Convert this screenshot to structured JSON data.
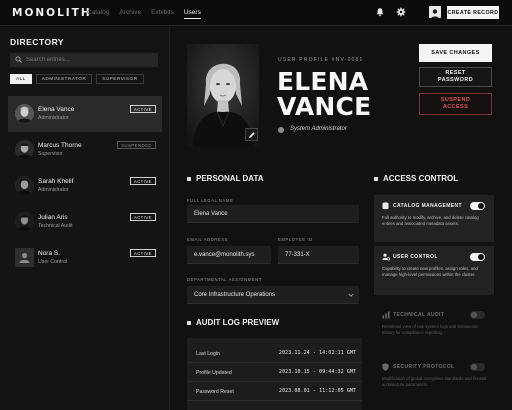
{
  "app": {
    "logo": "MONOLITH",
    "nav": [
      "Catalog",
      "Archive",
      "Exhibits",
      "Users"
    ],
    "nav_active": "Users",
    "create_label": "CREATE RECORD"
  },
  "sidebar": {
    "title": "DIRECTORY",
    "search_placeholder": "Search entries...",
    "filters": [
      "ALL",
      "ADMINISTRATOR",
      "SUPERVISOR"
    ],
    "filter_active": "ALL",
    "users": [
      {
        "name": "Elena Vance",
        "role": "Administrator",
        "status": "ACTIVE",
        "selected": true
      },
      {
        "name": "Marcus Thorne",
        "role": "Supervisor",
        "status": "SUSPENDED",
        "selected": false
      },
      {
        "name": "Sarah Khelif",
        "role": "Administrator",
        "status": "ACTIVE",
        "selected": false
      },
      {
        "name": "Julian Aris",
        "role": "Technical Audit",
        "status": "ACTIVE",
        "selected": false
      },
      {
        "name": "Nora S.",
        "role": "User Control",
        "status": "ACTIVE",
        "selected": false
      }
    ]
  },
  "profile": {
    "id_label": "USER PROFILE #NV-0081",
    "first_name": "ELENA",
    "last_name": "VANCE",
    "role": "System Administrator"
  },
  "actions": {
    "save": "SAVE CHANGES",
    "reset": "RESET\nPASSWORD",
    "suspend": "SUSPEND\nACCESS"
  },
  "personal": {
    "heading": "PERSONAL DATA",
    "full_name_label": "FULL LEGAL NAME",
    "full_name": "Elena Vance",
    "email_label": "EMAIL ADDRESS",
    "email": "e.vance@monolith.sys",
    "employee_label": "EMPLOYEE ID",
    "employee_id": "77-331-X",
    "dept_label": "DEPARTMENTAL ASSIGNMENT",
    "dept": "Core Infrastructure Operations"
  },
  "audit": {
    "heading": "AUDIT LOG PREVIEW",
    "rows": [
      {
        "event": "Last Login",
        "time": "2023.11.24 - 14:02:11 GMT"
      },
      {
        "event": "Profile Updated",
        "time": "2023.10.15 - 09:44:32 GMT"
      },
      {
        "event": "Password Reset",
        "time": "2023.08.01 - 11:12:05 GMT"
      }
    ]
  },
  "access": {
    "heading": "ACCESS CONTROL",
    "items": [
      {
        "title": "CATALOG MANAGEMENT",
        "desc": "Full authority to modify, archive, and delete catalog entries and associated metadata assets.",
        "enabled": true,
        "icon": "database-icon"
      },
      {
        "title": "USER CONTROL",
        "desc": "Capability to create new profiles, assign roles, and manage high-level permissions within the cluster.",
        "enabled": true,
        "icon": "user-gear-icon"
      },
      {
        "title": "TECHNICAL AUDIT",
        "desc": "Restricted view of raw system logs and transaction history for compliance reporting.",
        "enabled": false,
        "icon": "chart-icon"
      },
      {
        "title": "SECURITY PROTOCOL",
        "desc": "Modification of global encryption standards and firewall architecture parameters.",
        "enabled": false,
        "icon": "shield-icon"
      }
    ]
  }
}
